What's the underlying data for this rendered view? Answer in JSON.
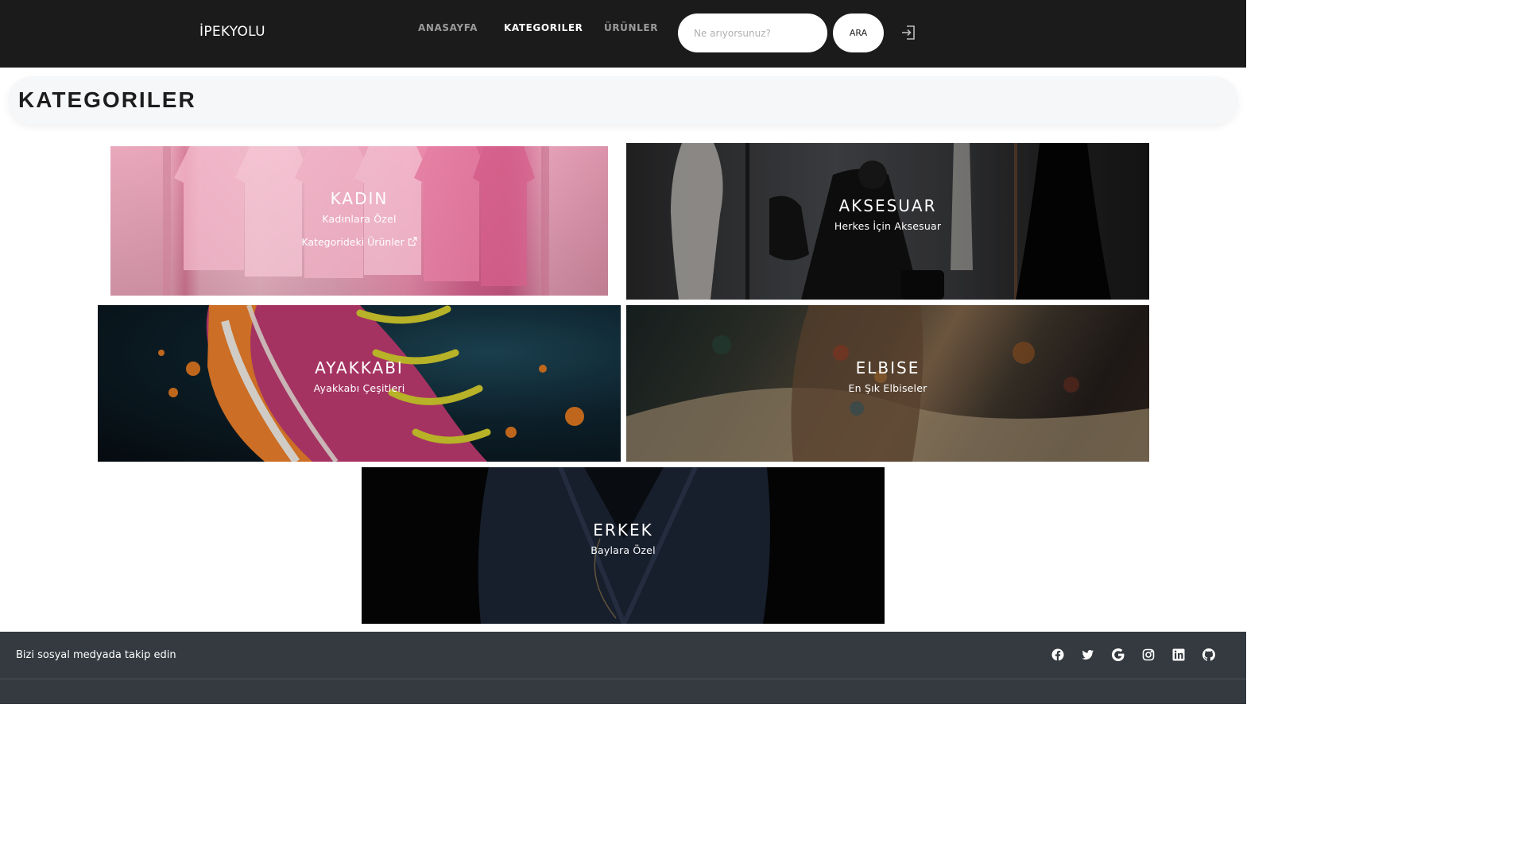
{
  "navbar": {
    "brand": "İPEKYOLU",
    "links": [
      "ANASAYFA",
      "KATEGORILER",
      "ÜRÜNLER"
    ],
    "active_index": 1,
    "search_placeholder": "Ne arıyorsunuz?",
    "search_button": "ARA",
    "login_icon": "sign-in-icon"
  },
  "header": {
    "title": "KATEGORILER"
  },
  "categories": [
    {
      "title": "KADIN",
      "subtitle": "Kadınlara Özel",
      "link": "Kategorideki Ürünler",
      "link_icon": "external-link-icon"
    },
    {
      "title": "AKSESUAR",
      "subtitle": "Herkes İçin Aksesuar"
    },
    {
      "title": "AYAKKABI",
      "subtitle": "Ayakkabı Çeşitleri"
    },
    {
      "title": "ELBISE",
      "subtitle": "En Şık Elbiseler"
    },
    {
      "title": "ERKEK",
      "subtitle": "Baylara Özel"
    }
  ],
  "footer": {
    "text": "Bizi sosyal medyada takip edin",
    "social_icons": [
      "facebook-icon",
      "twitter-icon",
      "google-icon",
      "instagram-icon",
      "linkedin-icon",
      "github-icon"
    ]
  },
  "colors": {
    "navbar": "#1b1b1b",
    "footer": "#343a40",
    "header_bg": "#f6f7f9"
  }
}
